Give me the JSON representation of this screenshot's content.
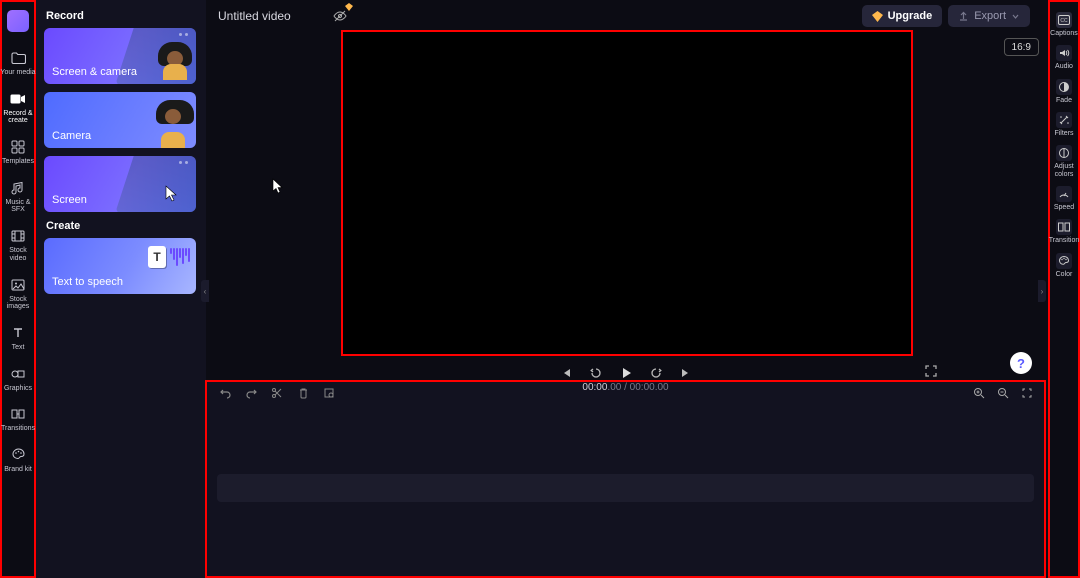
{
  "app": {
    "title": "Untitled video"
  },
  "header": {
    "upgrade_label": "Upgrade",
    "export_label": "Export",
    "hide_premium_tooltip": "Show/hide premium"
  },
  "aspect": {
    "label": "16:9"
  },
  "left_rail": {
    "items": [
      {
        "label": "Your media",
        "icon": "folder-icon"
      },
      {
        "label": "Record & create",
        "icon": "camera-icon"
      },
      {
        "label": "Templates",
        "icon": "templates-icon"
      },
      {
        "label": "Music & SFX",
        "icon": "music-icon"
      },
      {
        "label": "Stock video",
        "icon": "film-icon"
      },
      {
        "label": "Stock images",
        "icon": "image-icon"
      },
      {
        "label": "Text",
        "icon": "text-icon"
      },
      {
        "label": "Graphics",
        "icon": "graphics-icon"
      },
      {
        "label": "Transitions",
        "icon": "transitions-icon"
      },
      {
        "label": "Brand kit",
        "icon": "brand-icon"
      }
    ],
    "active_index": 1
  },
  "left_panel": {
    "section_record": "Record",
    "section_create": "Create",
    "record_items": [
      {
        "label": "Screen & camera"
      },
      {
        "label": "Camera"
      },
      {
        "label": "Screen"
      }
    ],
    "create_items": [
      {
        "label": "Text to speech"
      }
    ]
  },
  "right_rail": {
    "items": [
      {
        "label": "Captions",
        "icon": "captions-icon"
      },
      {
        "label": "Audio",
        "icon": "audio-icon"
      },
      {
        "label": "Fade",
        "icon": "fade-icon"
      },
      {
        "label": "Filters",
        "icon": "filters-icon"
      },
      {
        "label": "Adjust colors",
        "icon": "adjust-icon"
      },
      {
        "label": "Speed",
        "icon": "speed-icon"
      },
      {
        "label": "Transition",
        "icon": "transition-icon"
      },
      {
        "label": "Color",
        "icon": "color-icon"
      }
    ]
  },
  "playback": {
    "help": "?",
    "controls": [
      "skip-back",
      "step-back",
      "play",
      "step-fwd",
      "skip-fwd"
    ]
  },
  "timeline": {
    "current": "00:00",
    "current_frac": ".00",
    "sep": " / ",
    "total": "00:00",
    "total_frac": ".00"
  },
  "colors": {
    "accent": "#7b61ff",
    "highlight_border": "#ff0000"
  }
}
